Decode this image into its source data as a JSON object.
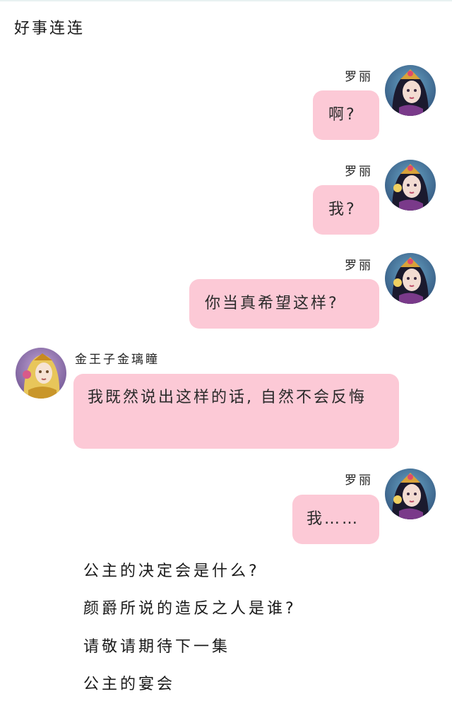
{
  "header": {
    "title": "好事连连"
  },
  "messages": [
    {
      "speaker": "罗丽",
      "text": "啊?",
      "side": "right",
      "avatar": "princess-avatar"
    },
    {
      "speaker": "罗丽",
      "text": "我?",
      "side": "right",
      "avatar": "princess-avatar"
    },
    {
      "speaker": "罗丽",
      "text": "你当真希望这样?",
      "side": "right",
      "avatar": "princess-avatar"
    },
    {
      "speaker": "金王子金璃瞳",
      "text": "我既然说出这样的话, 自然不会反悔",
      "side": "left",
      "avatar": "prince-avatar"
    },
    {
      "speaker": "罗丽",
      "text": "我……",
      "side": "right",
      "avatar": "princess-avatar"
    }
  ],
  "captions": [
    "公主的决定会是什么?",
    "颜爵所说的造反之人是谁?",
    "请敬请期待下一集",
    "公主的宴会"
  ],
  "colors": {
    "bubble": "#fcc9d6",
    "text": "#222222"
  }
}
